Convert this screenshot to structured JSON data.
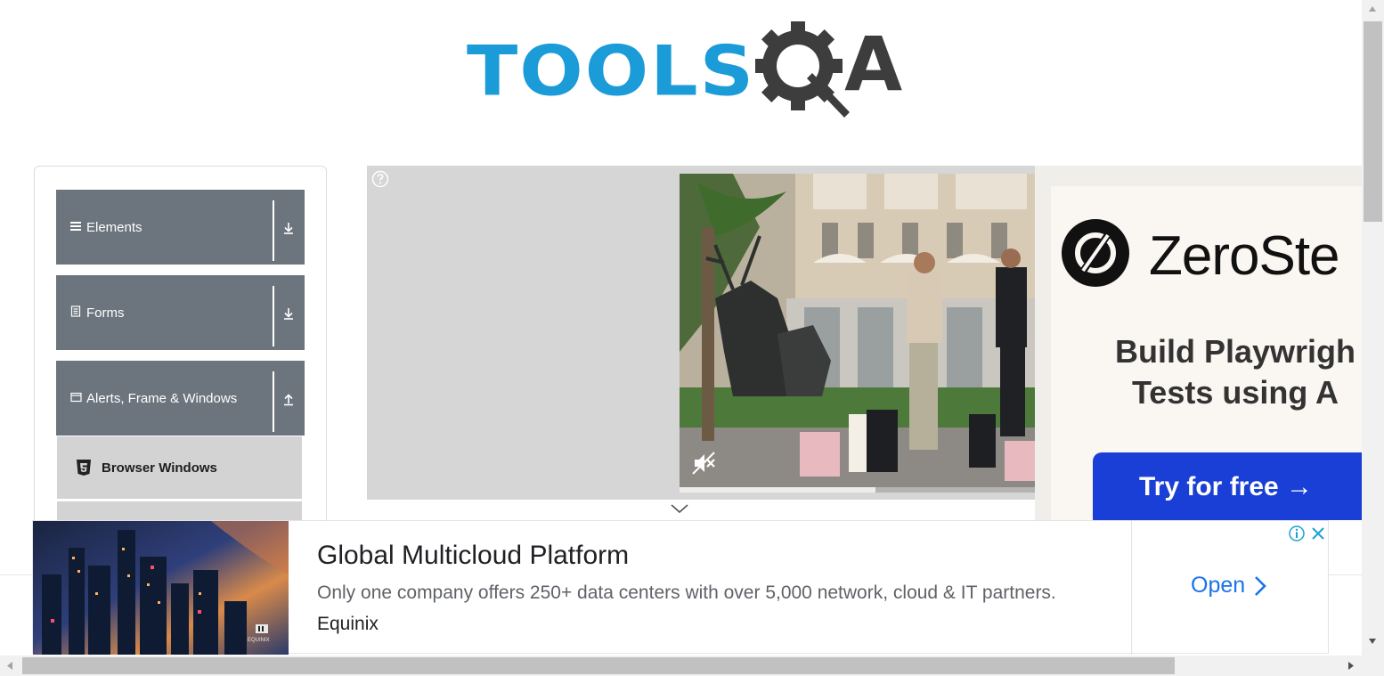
{
  "logo": {
    "tools_text": "TOOLS",
    "qa_a_text": "A"
  },
  "sidebar": {
    "groups": [
      {
        "label": "Elements",
        "icon": "hamburger-icon",
        "arrow": "download-arrow-icon"
      },
      {
        "label": "Forms",
        "icon": "document-icon",
        "arrow": "download-arrow-icon"
      },
      {
        "label": "Alerts, Frame & Windows",
        "icon": "window-icon",
        "arrow": "upload-arrow-icon"
      }
    ],
    "items": [
      {
        "label": "Browser Windows",
        "icon": "html5-icon"
      }
    ]
  },
  "video_ad": {
    "help_icon": "question-icon",
    "mute_icon": "muted-speaker-icon",
    "progress": 0.55
  },
  "zerostep_ad": {
    "brand": "ZeroSte",
    "headline_line1": "Build Playwrigh",
    "headline_line2": "Tests using A",
    "cta": "Try for free →",
    "colors": {
      "cta": "#1a3fd6"
    }
  },
  "bottom_ad": {
    "title": "Global Multicloud Platform",
    "description": "Only one company offers 250+ data centers with over 5,000 network, cloud & IT partners.",
    "brand": "Equinix",
    "image_caption": "EQUINIX",
    "open_label": "Open",
    "colors": {
      "open": "#1a73e8"
    }
  },
  "colors": {
    "logo_blue": "#1b9bd7",
    "logo_gray": "#3d3d3d",
    "menu_header": "#6c757d",
    "menu_item": "#d3d3d3"
  }
}
